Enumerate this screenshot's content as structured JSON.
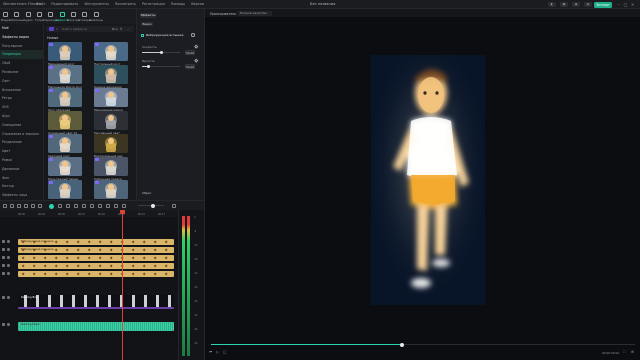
{
  "topbar": {
    "app_title": "Wondershare Filmora",
    "menu": [
      "Файл",
      "Редактировать",
      "Инструменты",
      "Посмотреть",
      "Регистрация",
      "Помощь",
      "Версия"
    ],
    "doc_title": "Без названия",
    "export_label": "Экспорт"
  },
  "categories": [
    {
      "label": "Медиа",
      "active": false
    },
    {
      "label": "Облачные",
      "active": false
    },
    {
      "label": "Аудио",
      "active": false
    },
    {
      "label": "Титры",
      "active": false
    },
    {
      "label": "Переходы",
      "active": false
    },
    {
      "label": "Эффекты",
      "active": true
    },
    {
      "label": "Фильтры",
      "active": false
    },
    {
      "label": "Стикеры",
      "active": false
    },
    {
      "label": "Шаблоны",
      "active": false
    }
  ],
  "category_list": [
    {
      "label": "Моё",
      "state": "sel"
    },
    {
      "label": "Эффекты видео",
      "state": "sel"
    },
    {
      "label": "Популярное",
      "state": ""
    },
    {
      "label": "Тенденции",
      "state": "active"
    },
    {
      "label": "Сбой",
      "state": ""
    },
    {
      "label": "Размытие",
      "state": ""
    },
    {
      "label": "Свет",
      "state": ""
    },
    {
      "label": "Искажение",
      "state": ""
    },
    {
      "label": "Ретро",
      "state": ""
    },
    {
      "label": "VHS",
      "state": ""
    },
    {
      "label": "Шум",
      "state": ""
    },
    {
      "label": "Освещение",
      "state": ""
    },
    {
      "label": "Отражение и зеркало",
      "state": ""
    },
    {
      "label": "Разделение",
      "state": ""
    },
    {
      "label": "Цвет",
      "state": ""
    },
    {
      "label": "Рамка",
      "state": ""
    },
    {
      "label": "Движение",
      "state": ""
    },
    {
      "label": "Фон",
      "state": ""
    },
    {
      "label": "Контур",
      "state": ""
    },
    {
      "label": "Эффекты лица",
      "state": ""
    }
  ],
  "effects": {
    "search_placeholder": "Найти эффекты",
    "filter_label": "Все",
    "section_title": "Новые",
    "items": [
      {
        "label": "Мерцающий круг",
        "bg": "#3a5a7a",
        "fg": "#e8d6c0",
        "badge": true
      },
      {
        "label": "Пастельный круг",
        "bg": "#4a6a88",
        "fg": "#f0e0d0",
        "badge": true
      },
      {
        "label": "Маленькая Дзета круг",
        "bg": "#5a7085",
        "fg": "#e9e1d8",
        "badge": true
      },
      {
        "label": "Камера движения",
        "bg": "#2e4f5c",
        "fg": "#d8c3ad",
        "badge": false
      },
      {
        "label": "Круг обзорная",
        "bg": "#4f6a7d",
        "fg": "#e2d4c2",
        "badge": true
      },
      {
        "label": "Мерцающая рамка",
        "bg": "#6a7b92",
        "fg": "#d7dfe8",
        "badge": true
      },
      {
        "label": "Солнечный свет 01",
        "bg": "#5b5a3a",
        "fg": "#f2d480",
        "badge": false
      },
      {
        "label": "Рассеянный свет",
        "bg": "#2d2f36",
        "fg": "#a9a9b0",
        "badge": false
      },
      {
        "label": "Световой круг",
        "bg": "#52687a",
        "fg": "#eee0cf",
        "badge": true
      },
      {
        "label": "Вертикальный мех",
        "bg": "#3b3521",
        "fg": "#d9b24a",
        "badge": false
      },
      {
        "label": "Мультяшный перед",
        "bg": "#5a6f86",
        "fg": "#f1e2d3",
        "badge": true
      },
      {
        "label": "Рубленная пересе",
        "bg": "#4b5567",
        "fg": "#e5e0da",
        "badge": true
      },
      {
        "label": "Зеркальный эффект",
        "bg": "#48627a",
        "fg": "#e8d9c8",
        "badge": true
      },
      {
        "label": "Облачная грань",
        "bg": "#4e6478",
        "fg": "#e9dccb",
        "badge": true
      }
    ]
  },
  "properties": {
    "tab_label": "Эффекты",
    "sub_label": "Видео",
    "effect_name": "Вибрирующая вспышка",
    "params": [
      {
        "label": "Скорость",
        "value": "50.00",
        "fraction": 0.5
      },
      {
        "label": "Яркость",
        "value": "50.00",
        "fraction": 0.18
      }
    ],
    "reset_label": "Сброс"
  },
  "player": {
    "tab1": "Проигрыватель",
    "tab2": "Полное качество",
    "progress": 0.45,
    "time": "00:00:00:00"
  },
  "timeline": {
    "ruler": [
      "00:00",
      "00:02",
      "00:05",
      "00:07",
      "00:10",
      "00:12",
      "00:15",
      "00:17"
    ],
    "clips": [
      {
        "label": "Вибрирующая вспышка",
        "color": "#d9b56a"
      },
      {
        "label": "Вибрирующая вспышка",
        "color": "#d9b56a"
      },
      {
        "label": "",
        "color": "#d9b56a"
      },
      {
        "label": "",
        "color": "#d9b56a"
      },
      {
        "label": "",
        "color": "#d9b56a"
      },
      {
        "label": "Dancing Boy",
        "color": "#6a3fa8"
      },
      {
        "label": "Dancing Music",
        "color": "#2fb08c"
      }
    ]
  },
  "colors": {
    "accent": "#2bd3b0",
    "export": "#1fae8a",
    "playhead": "#e0423a"
  }
}
